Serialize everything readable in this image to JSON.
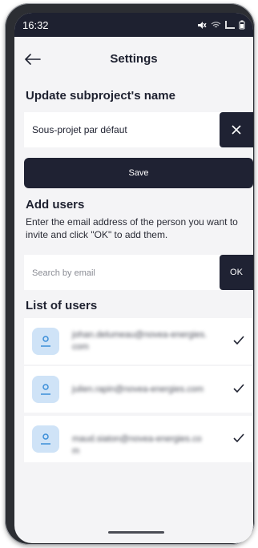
{
  "status_bar": {
    "time": "16:32"
  },
  "header": {
    "title": "Settings"
  },
  "rename": {
    "title": "Update subproject's name",
    "value": "Sous-projet par défaut",
    "save_label": "Save"
  },
  "add_users": {
    "title": "Add users",
    "description": "Enter the email address of the person you want to invite and click \"OK\" to add them.",
    "placeholder": "Search by email",
    "ok_label": "OK"
  },
  "users": {
    "title": "List of users",
    "items": [
      {
        "email": "johan.delumeau@novea-energies.com"
      },
      {
        "email": "julien.rapin@novea-energies.com"
      },
      {
        "email": "maud.siaton@novea-energies.com"
      }
    ]
  },
  "colors": {
    "dark": "#1f2233",
    "background": "#f4f4f6",
    "avatar": "#cfe3f7",
    "accent": "#3b8ed8"
  }
}
